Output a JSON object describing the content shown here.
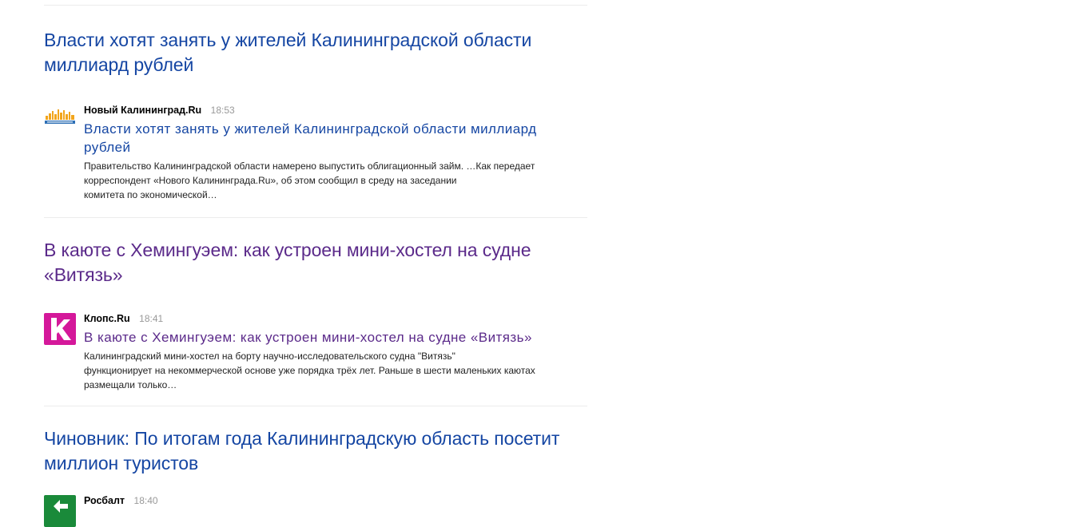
{
  "stories": [
    {
      "title": "Власти хотят занять у жителей Калининградской области миллиард рублей",
      "visited": false,
      "source": "Новый Калининград.Ru",
      "time": "18:53",
      "logo": "novy-kaliningrad-logo",
      "item_title": "Власти хотят занять у жителей Калининградской области миллиард рублей",
      "snippet_lines": [
        "Правительство Калининградской области намерено выпустить облигационный займ. …Как передает",
        "корреспондент «Нового Калининграда.Ru», об этом сообщил в среду на заседании",
        "комитета по экономической…"
      ]
    },
    {
      "title": "В каюте с Хемингуэем: как устроен мини-хостел на судне «Витязь»",
      "visited": true,
      "source": "Клопс.Ru",
      "time": "18:41",
      "logo": "klops-logo",
      "item_title": "В каюте с Хемингуэем: как устроен мини-хостел на судне «Витязь»",
      "snippet_lines": [
        "Калининградский мини-хостел на борту научно-исследовательского судна \"Витязь\"",
        "функционирует на некоммерческой основе уже порядка трёх лет. Раньше в шести маленьких каютах",
        "размещали только…"
      ]
    },
    {
      "title": "Чиновник: По итогам года Калининградскую область посетит миллион туристов",
      "visited": false,
      "source": "Росбалт",
      "time": "18:40",
      "logo": "rosbalt-logo"
    }
  ],
  "colors": {
    "link": "#1546a3",
    "visited": "#5b2a8a",
    "time": "#999999",
    "divider": "#ececec"
  }
}
